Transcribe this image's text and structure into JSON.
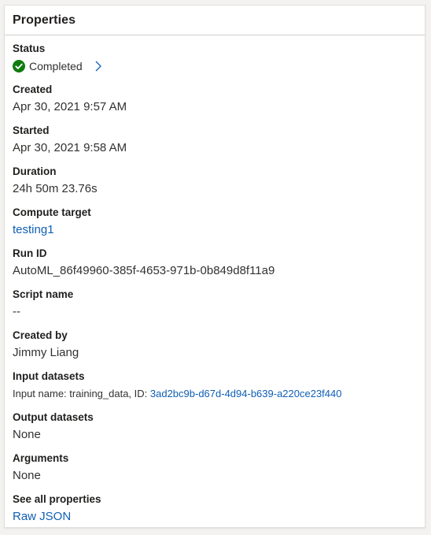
{
  "panel": {
    "title": "Properties"
  },
  "properties": {
    "status": {
      "label": "Status",
      "value": "Completed",
      "icon": "check-circle-icon",
      "color": "#107c10"
    },
    "created": {
      "label": "Created",
      "value": "Apr 30, 2021 9:57 AM"
    },
    "started": {
      "label": "Started",
      "value": "Apr 30, 2021 9:58 AM"
    },
    "duration": {
      "label": "Duration",
      "value": "24h 50m 23.76s"
    },
    "compute_target": {
      "label": "Compute target",
      "value": "testing1"
    },
    "run_id": {
      "label": "Run ID",
      "value": "AutoML_86f49960-385f-4653-971b-0b849d8f11a9"
    },
    "script_name": {
      "label": "Script name",
      "value": "--"
    },
    "created_by": {
      "label": "Created by",
      "value": "Jimmy Liang"
    },
    "input_datasets": {
      "label": "Input datasets",
      "prefix": "Input name: training_data, ID: ",
      "id_link": "3ad2bc9b-d67d-4d94-b639-a220ce23f440"
    },
    "output_datasets": {
      "label": "Output datasets",
      "value": "None"
    },
    "arguments": {
      "label": "Arguments",
      "value": "None"
    },
    "see_all": {
      "label": "See all properties",
      "link": "Raw JSON"
    }
  },
  "colors": {
    "link": "#0f5fb5",
    "success": "#107c10",
    "chevron": "#0f5fb5"
  }
}
